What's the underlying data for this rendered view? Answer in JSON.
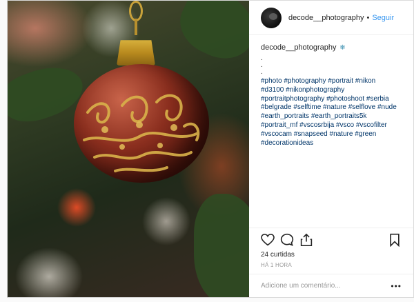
{
  "header": {
    "username": "decode__photography",
    "separator": "•",
    "follow_label": "Seguir"
  },
  "caption": {
    "username": "decode__photography",
    "emoji": "❄",
    "dots": [
      ".",
      ".",
      "."
    ],
    "hashtag_lines": [
      "#photo #photography #portrait #nikon",
      "#d3100 #nikonphotography",
      "#portraitphotography #photoshoot #serbia",
      "#belgrade #selftime #nature #selflove #nude",
      "#earth_portraits #earth_portraits5k",
      "#portrait_mf #vscosrbija #vsco #vscofilter",
      "#vscocam #snapseed #nature #green",
      "#decorationideas"
    ]
  },
  "stats": {
    "likes": "24 curtidas",
    "time": "HÁ 1 HORA"
  },
  "comment": {
    "placeholder": "Adicione um comentário...",
    "more": "•••"
  },
  "icons": {
    "like": "heart-icon",
    "comment": "comment-icon",
    "share": "share-icon",
    "save": "bookmark-icon",
    "emoji": "snowflake-icon"
  },
  "colors": {
    "follow": "#3897f0",
    "hashtag": "#003569",
    "muted": "#999999"
  }
}
